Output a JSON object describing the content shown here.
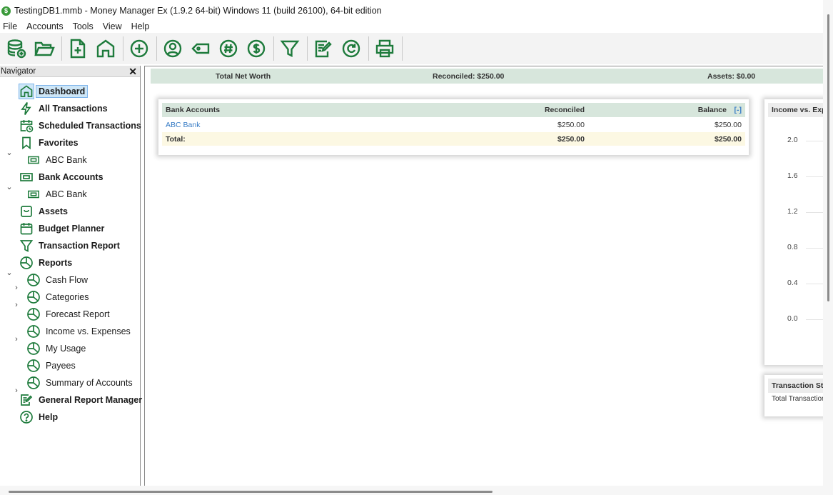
{
  "window": {
    "title": "TestingDB1.mmb - Money Manager Ex (1.9.2 64-bit) Windows 11 (build 26100), 64-bit edition",
    "app_icon_glyph": "$"
  },
  "menu": [
    "File",
    "Accounts",
    "Tools",
    "View",
    "Help"
  ],
  "toolbar": {
    "icons": [
      "database-add-icon",
      "open-folder-icon",
      "new-file-icon",
      "home-icon",
      "new-transaction-icon",
      "payee-icon",
      "tag-icon",
      "hash-icon",
      "currency-icon",
      "filter-icon",
      "edit-report-icon",
      "refresh-icon",
      "print-icon"
    ],
    "color": "#1e7b3c"
  },
  "navigator": {
    "title": "Navigator",
    "close_glyph": "✕",
    "items": [
      {
        "label": "Dashboard",
        "icon": "home-icon",
        "bold": true,
        "selected": true
      },
      {
        "label": "All Transactions",
        "icon": "lightning-icon",
        "bold": true
      },
      {
        "label": "Scheduled Transactions",
        "icon": "calendar-clock-icon",
        "bold": true
      },
      {
        "label": "Favorites",
        "icon": "bookmark-icon",
        "bold": true,
        "expanded": true
      },
      {
        "label": "ABC Bank",
        "icon": "bank-account-icon"
      },
      {
        "label": "Bank Accounts",
        "icon": "bank-account-icon",
        "bold": true,
        "expanded": true
      },
      {
        "label": "ABC Bank",
        "icon": "bank-account-icon"
      },
      {
        "label": "Assets",
        "icon": "assets-icon",
        "bold": true
      },
      {
        "label": "Budget Planner",
        "icon": "calendar-icon",
        "bold": true
      },
      {
        "label": "Transaction Report",
        "icon": "funnel-icon",
        "bold": true
      },
      {
        "label": "Reports",
        "icon": "pie-chart-icon",
        "bold": true,
        "expanded": true
      },
      {
        "label": "Cash Flow",
        "icon": "pie-chart-icon",
        "collapsed": true
      },
      {
        "label": "Categories",
        "icon": "pie-chart-icon",
        "collapsed": true
      },
      {
        "label": "Forecast Report",
        "icon": "pie-chart-icon"
      },
      {
        "label": "Income vs. Expenses",
        "icon": "pie-chart-icon",
        "collapsed": true
      },
      {
        "label": "My Usage",
        "icon": "pie-chart-icon"
      },
      {
        "label": "Payees",
        "icon": "pie-chart-icon"
      },
      {
        "label": "Summary of Accounts",
        "icon": "pie-chart-icon",
        "collapsed": true
      },
      {
        "label": "General Report Manager",
        "icon": "edit-report-icon",
        "bold": true
      },
      {
        "label": "Help",
        "icon": "help-icon",
        "bold": true
      }
    ]
  },
  "dashboard": {
    "summary": {
      "total_net_worth": "Total Net Worth",
      "reconciled": "Reconciled: $250.00",
      "assets": "Assets: $0.00"
    },
    "bank_accounts": {
      "headers": {
        "name": "Bank Accounts",
        "reconciled": "Reconciled",
        "balance": "Balance",
        "collapse": "[-]"
      },
      "rows": [
        {
          "name": "ABC Bank",
          "reconciled": "$250.00",
          "balance": "$250.00"
        }
      ],
      "total": {
        "name": "Total:",
        "reconciled": "$250.00",
        "balance": "$250.00"
      }
    },
    "income_chart": {
      "title": "Income vs. Exp",
      "y_ticks": [
        "2.0",
        "1.6",
        "1.2",
        "0.8",
        "0.4",
        "0.0"
      ]
    },
    "transaction_stats": {
      "title": "Transaction Sta",
      "row": "Total Transaction"
    }
  },
  "colors": {
    "accent_green": "#1e7b3c",
    "header_green": "#d7e6dc",
    "link_blue": "#3a7ec6",
    "total_row": "#fcf8e3"
  }
}
